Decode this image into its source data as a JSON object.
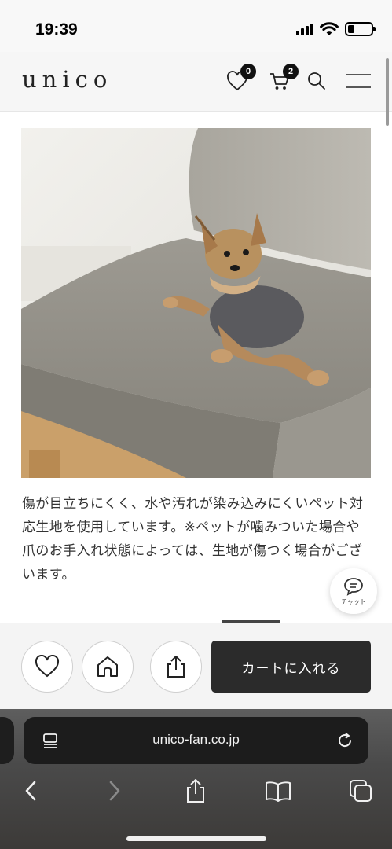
{
  "status_bar": {
    "time": "19:39",
    "battery_level": 0.3,
    "icons": [
      "cellular-signal-icon",
      "wifi-icon",
      "battery-icon"
    ]
  },
  "header": {
    "logo": "unico",
    "wishlist_count": "0",
    "cart_count": "2",
    "icons": [
      "heart-icon",
      "cart-icon",
      "search-icon",
      "menu-icon"
    ]
  },
  "content": {
    "image_subject": "yorkshire terrier on grey sofa",
    "description": "傷が目立ちにくく、水や汚れが染み込みにくいペット対応生地を使用しています。※ペットが噛みついた場合や爪のお手入れ状態によっては、生地が傷つく場合がございます。"
  },
  "chat": {
    "label": "チャット",
    "icon": "chat-bubble-icon"
  },
  "actions": {
    "icons": [
      "heart-outline-icon",
      "shop-home-icon",
      "share-icon"
    ],
    "cart_label": "カートに入れる"
  },
  "browser": {
    "url": "unico-fan.co.jp",
    "icons": [
      "page-menu-icon",
      "reload-icon",
      "back-icon",
      "forward-icon",
      "share-icon",
      "bookmarks-icon",
      "tabs-icon"
    ]
  },
  "colors": {
    "header_bg": "#f6f6f6",
    "badge": "#111111",
    "cart_button": "#2b2b2b",
    "browser_chrome": "#4a4a4a"
  }
}
